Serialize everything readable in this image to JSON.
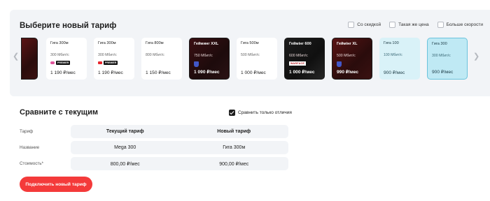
{
  "tariff_picker": {
    "title": "Выберите новый тариф",
    "filters": [
      {
        "label": "Со скидкой",
        "checked": false
      },
      {
        "label": "Такая же цена",
        "checked": false
      },
      {
        "label": "Больше скорости",
        "checked": false
      }
    ],
    "prev_icon": "chevron-left-icon",
    "next_icon": "chevron-right-icon",
    "cards": [
      {
        "name": "",
        "speed": "",
        "price": "",
        "theme": "dark-red-cut"
      },
      {
        "name": "Гига 300м",
        "speed": "300 Мбит/с",
        "price": "1 190 ₽/мес",
        "theme": "white",
        "badge": "PREMIER",
        "badge_dot_color": "#e0559c"
      },
      {
        "name": "Гига 300м",
        "speed": "300 Мбит/с",
        "price": "1 190 ₽/мес",
        "theme": "white",
        "badge": "PREMIER",
        "badge_dot_color": "#e8262d"
      },
      {
        "name": "Гига 800м",
        "speed": "800 Мбит/с",
        "price": "1 150 ₽/мес",
        "theme": "white"
      },
      {
        "name": "Гейминг XXL",
        "speed": "750 Мбит/с",
        "price": "1 090 ₽/мес",
        "theme": "dark-red",
        "badge_icon": "shield-icon"
      },
      {
        "name": "Гига 500м",
        "speed": "500 Мбит/с",
        "price": "1 000 ₽/мес",
        "theme": "white"
      },
      {
        "name": "Геймінг 600",
        "speed": "600 Мбит/с",
        "price": "1 000 ₽/мес",
        "theme": "dark",
        "badge": "WARFACE"
      },
      {
        "name": "Геймінг XL",
        "speed": "500 Мбит/с",
        "price": "990 ₽/мес",
        "theme": "dark-red",
        "badge_icon": "shield-icon"
      },
      {
        "name": "Гига 100",
        "speed": "100 Мбит/с",
        "price": "900 ₽/мес",
        "theme": "light-blue"
      },
      {
        "name": "Гига 300",
        "speed": "300 Мбит/с",
        "price": "900 ₽/мес",
        "theme": "light-blue-selected"
      }
    ]
  },
  "compare": {
    "title": "Сравните с текущим",
    "only_differences_label": "Сравнить только отличия",
    "only_differences_checked": true,
    "rows": [
      {
        "label": "Тариф",
        "current": "Текущий тариф",
        "new": "Новый тариф"
      },
      {
        "label": "Название",
        "current": "Mega 300",
        "new": "Гига 300м"
      },
      {
        "label": "Стоимость*",
        "current": "800,00 ₽/мес",
        "new": "900,00 ₽/мес"
      }
    ],
    "connect_button": "Подключить новый тариф"
  },
  "colors": {
    "accent": "#f43a3a",
    "panel_bg": "#f2f4f7",
    "selected_card": "#bfe9f4"
  }
}
